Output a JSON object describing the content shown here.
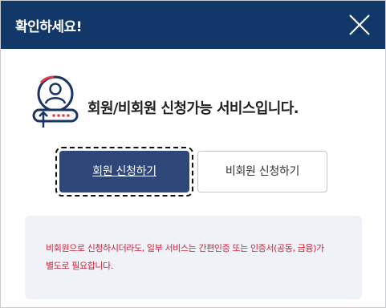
{
  "dialog": {
    "title": "확인하세요!",
    "close_icon": "close-icon"
  },
  "message": {
    "icon": "user-login-icon",
    "text": "회원/비회원 신청가능 서비스입니다."
  },
  "buttons": {
    "member_label": "회원 신청하기",
    "guest_label": "비회원 신청하기"
  },
  "notice": {
    "line1": "비회원으로 신청하시더라도, 일부 서비스는 간편인증 또는 인증서(공동, 금융)가",
    "line2": "별도로 필요합니다."
  },
  "colors": {
    "header_bg": "#12386a",
    "primary_button": "#2e4778",
    "icon_accent": "#1a3468",
    "notice_text": "#d0213b",
    "notice_bg": "#eff2f6"
  }
}
